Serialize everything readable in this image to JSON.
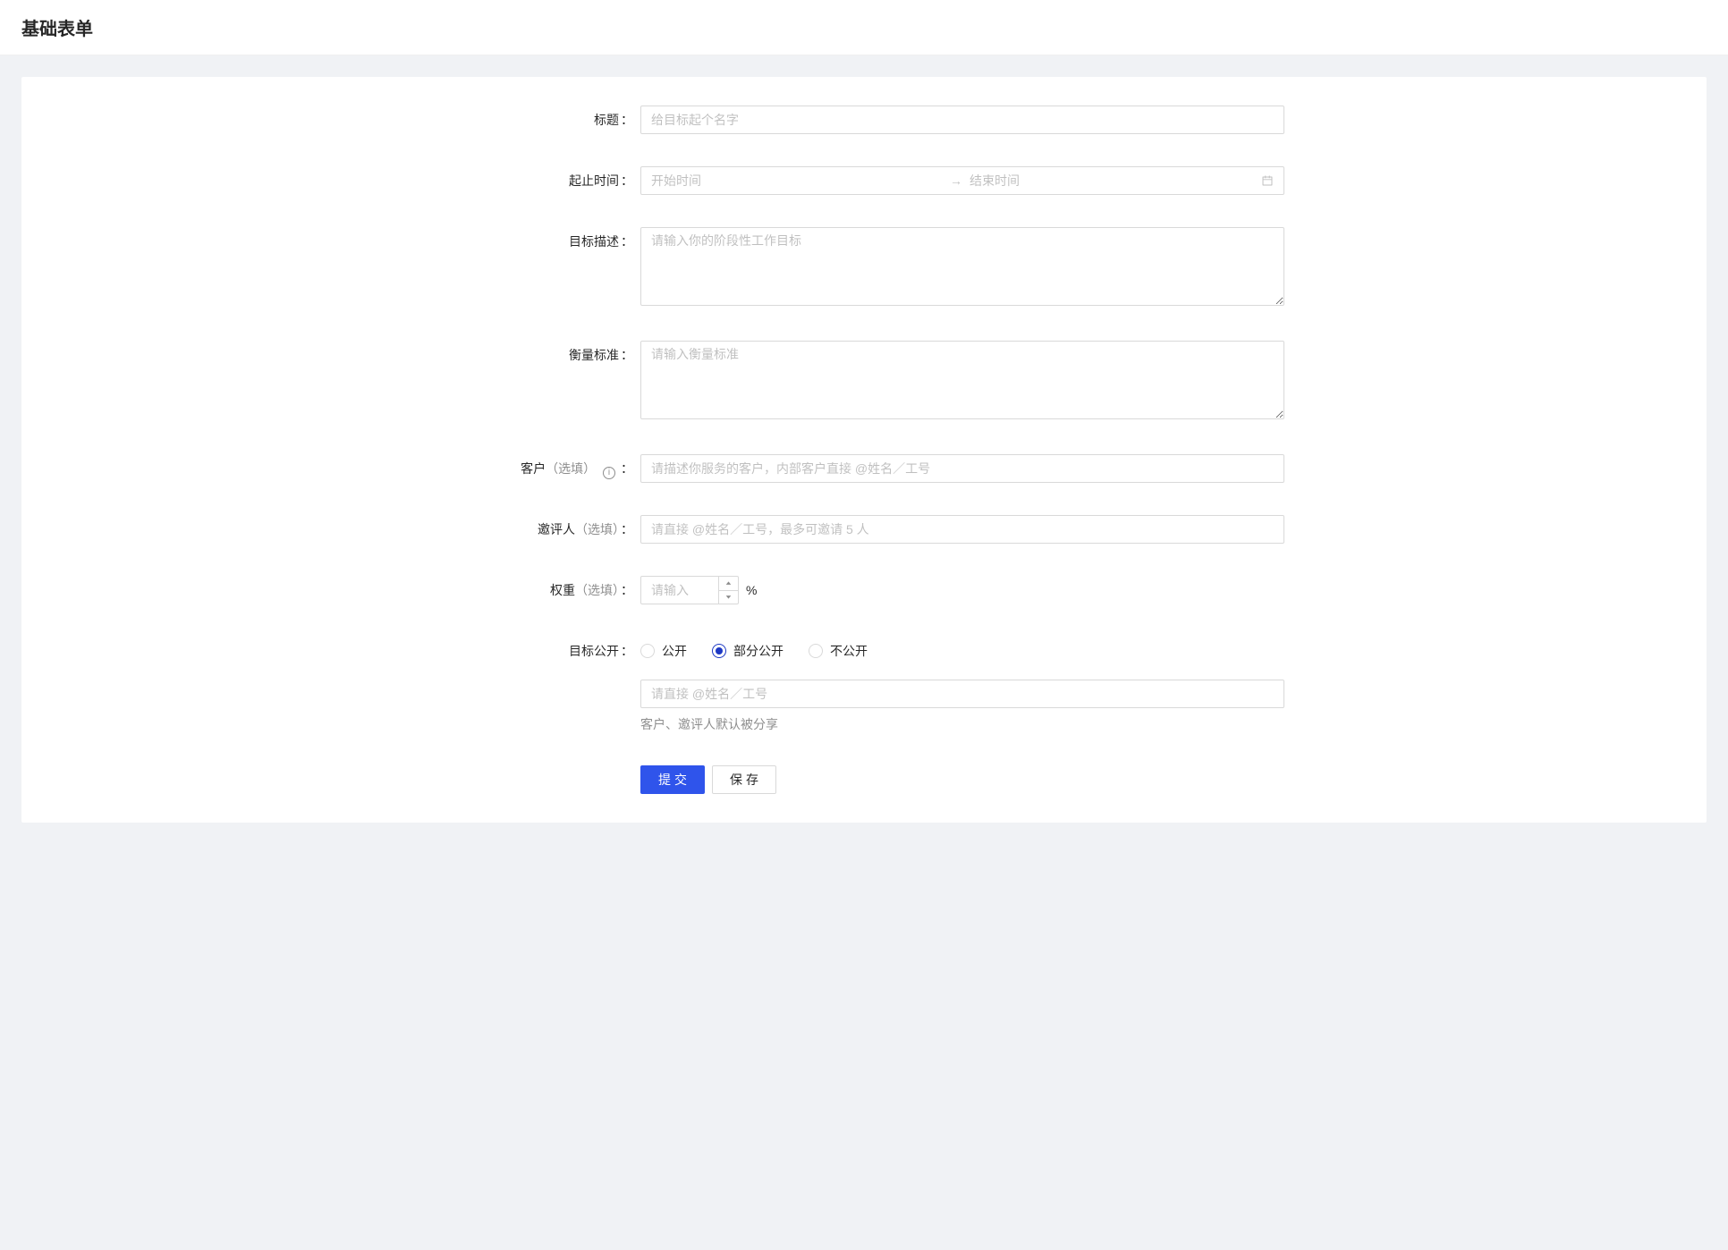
{
  "header": {
    "title": "基础表单"
  },
  "form": {
    "title": {
      "label": "标题",
      "placeholder": "给目标起个名字"
    },
    "dateRange": {
      "label": "起止时间",
      "startPlaceholder": "开始时间",
      "endPlaceholder": "结束时间",
      "separator": "→"
    },
    "goalDesc": {
      "label": "目标描述",
      "placeholder": "请输入你的阶段性工作目标"
    },
    "standard": {
      "label": "衡量标准",
      "placeholder": "请输入衡量标准"
    },
    "client": {
      "label": "客户",
      "optional": "（选填）",
      "placeholder": "请描述你服务的客户，内部客户直接 @姓名／工号"
    },
    "reviewer": {
      "label": "邀评人",
      "optional": "（选填）",
      "placeholder": "请直接 @姓名／工号，最多可邀请 5 人"
    },
    "weight": {
      "label": "权重",
      "optional": "（选填）",
      "placeholder": "请输入",
      "suffix": "%"
    },
    "publicity": {
      "label": "目标公开",
      "options": {
        "public": "公开",
        "partial": "部分公开",
        "private": "不公开"
      },
      "selected": "partial",
      "sharePlaceholder": "请直接 @姓名／工号",
      "help": "客户、邀评人默认被分享"
    },
    "buttons": {
      "submit": "提交",
      "save": "保存"
    },
    "colon": "："
  }
}
